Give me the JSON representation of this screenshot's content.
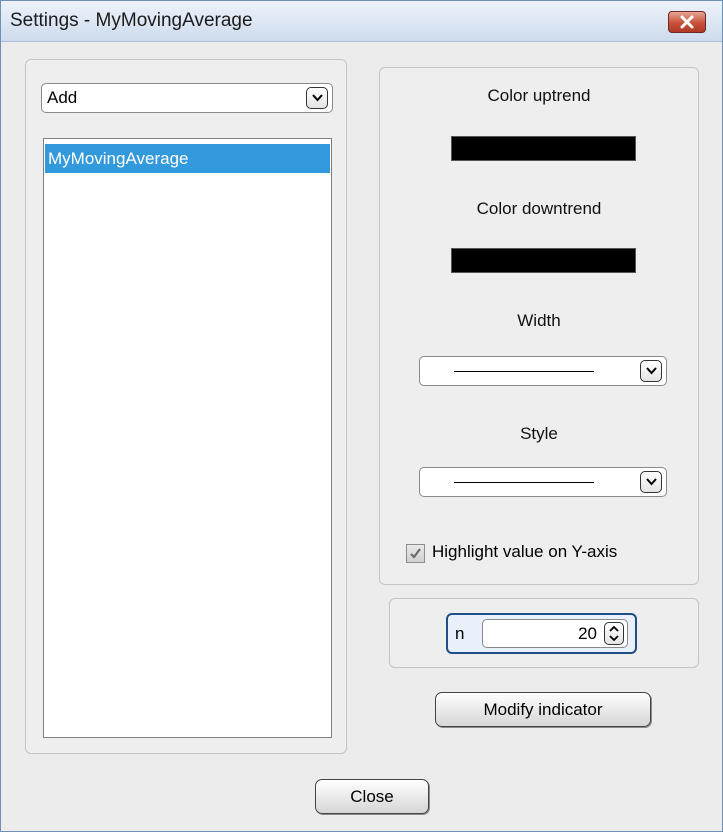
{
  "window": {
    "title": "Settings - MyMovingAverage",
    "close_icon": "close-x-icon"
  },
  "left_panel": {
    "add_combo": {
      "value": "Add"
    },
    "indicators": [
      {
        "label": "MyMovingAverage",
        "selected": true
      }
    ]
  },
  "right_panel": {
    "color_uptrend": {
      "label": "Color uptrend",
      "color": "#000000"
    },
    "color_downtrend": {
      "label": "Color downtrend",
      "color": "#000000"
    },
    "width": {
      "label": "Width"
    },
    "style": {
      "label": "Style"
    },
    "highlight": {
      "label": "Highlight value on Y-axis",
      "checked": true
    }
  },
  "params": {
    "n_label": "n",
    "n_value": "20"
  },
  "buttons": {
    "modify": "Modify indicator",
    "close": "Close"
  },
  "colors": {
    "selection": "#3399dd",
    "focus_border": "#1e4f86"
  }
}
